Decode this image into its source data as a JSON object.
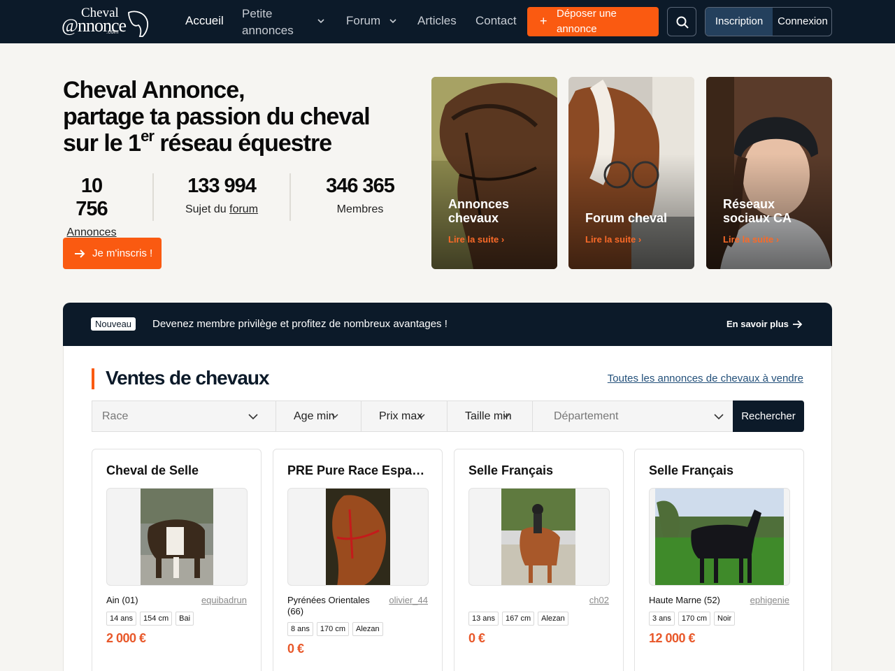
{
  "nav": {
    "logo": {
      "line1": "Cheval",
      "line2": "@nnonce",
      "line3": ".com"
    },
    "links": [
      "Accueil",
      "Petite annonces",
      "Forum",
      "Articles",
      "Contact"
    ],
    "deposit_label": "Déposer une annonce",
    "signup_label": "Inscription",
    "login_label": "Connexion"
  },
  "hero": {
    "line1": "Cheval Annonce,",
    "line2": "partage ta passion du cheval",
    "line3_pre": "sur le 1",
    "line3_sup": "er",
    "line3_post": " réseau équestre",
    "stats": [
      {
        "value": "10 756",
        "label": "Annonces"
      },
      {
        "value": "133 994",
        "label_pre": "Sujet du ",
        "label_link": "forum"
      },
      {
        "value": "346 365",
        "label": "Membres"
      }
    ],
    "cta_label": "Je m'inscris !"
  },
  "cards": [
    {
      "title": "Annonces chevaux",
      "link": "Lire la suite"
    },
    {
      "title": "Forum cheval",
      "link": "Lire la suite"
    },
    {
      "title": "Réseaux sociaux CA",
      "link": "Lire la suite"
    }
  ],
  "banner": {
    "badge": "Nouveau",
    "text": "Devenez membre privilège et profitez de nombreux avantages !",
    "more": "En savoir plus"
  },
  "sales": {
    "title": "Ventes de chevaux",
    "all_link": "Toutes les annonces de chevaux à vendre",
    "filters": {
      "race": "Race",
      "age": "Age min",
      "price": "Prix max",
      "height": "Taille min",
      "dept": "Département"
    },
    "search_label": "Rechercher",
    "listings": [
      {
        "title": "Cheval de Selle",
        "location": "Ain (01)",
        "user": "equibadrun",
        "tags": [
          "14 ans",
          "154 cm",
          "Bai"
        ],
        "price": "2 000 €"
      },
      {
        "title": "PRE Pure Race Espagnole",
        "location": "Pyrénées Orientales (66)",
        "user": "olivier_44",
        "tags": [
          "8 ans",
          "170 cm",
          "Alezan"
        ],
        "price": "0 €"
      },
      {
        "title": "Selle Français",
        "location": "",
        "user": "ch02",
        "tags": [
          "13 ans",
          "167 cm",
          "Alezan"
        ],
        "price": "0 €"
      },
      {
        "title": "Selle Français",
        "location": "Haute Marne (52)",
        "user": "ephigenie",
        "tags": [
          "3 ans",
          "170 cm",
          "Noir"
        ],
        "price": "12 000 €"
      }
    ]
  },
  "colors": {
    "navy": "#0c1a29",
    "orange": "#fa5a11",
    "link_blue": "#23507a",
    "price": "#e8582a"
  }
}
